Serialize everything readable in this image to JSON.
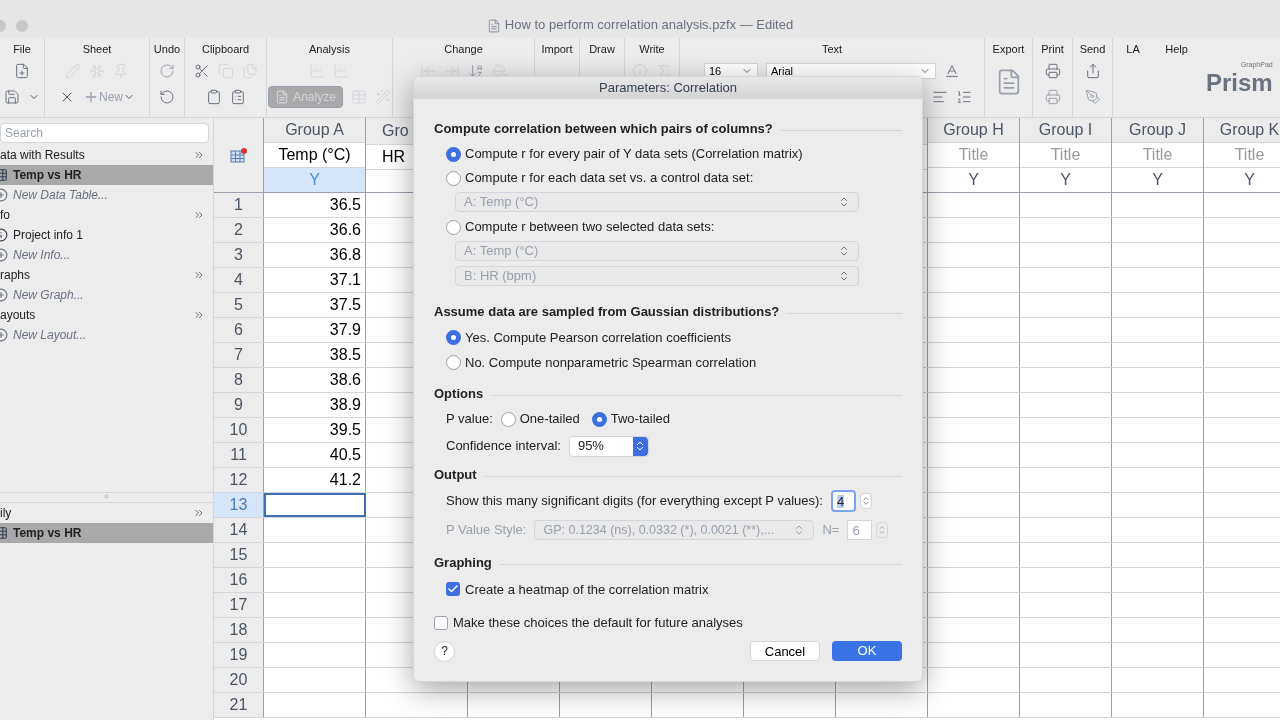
{
  "window": {
    "title": "How to perform correlation analysis.pzfx — Edited"
  },
  "toolbar": {
    "groups": [
      {
        "label": "File"
      },
      {
        "label": "Sheet"
      },
      {
        "label": "Undo"
      },
      {
        "label": "Clipboard"
      },
      {
        "label": "Analysis"
      },
      {
        "label": "Change"
      },
      {
        "label": "Import"
      },
      {
        "label": "Draw"
      },
      {
        "label": "Write"
      },
      {
        "label": "Text"
      },
      {
        "label": "Export"
      },
      {
        "label": "Print"
      },
      {
        "label": "Send"
      },
      {
        "label": "LA"
      },
      {
        "label": "Help"
      }
    ],
    "new_button": "New",
    "analyze_button": "Analyze",
    "font_size": "16",
    "font_name": "Arial",
    "logo_small": "GraphPad",
    "logo": "Prism"
  },
  "sidebar": {
    "search_placeholder": "Search",
    "sections": [
      {
        "title": "ata with Results",
        "items": [
          {
            "label": "Temp vs HR",
            "kind": "table",
            "selected": true
          },
          {
            "label": "New Data Table...",
            "kind": "new",
            "selected": false
          }
        ]
      },
      {
        "title": "fo",
        "items": [
          {
            "label": "Project info 1",
            "kind": "info",
            "selected": false
          },
          {
            "label": "New Info...",
            "kind": "new",
            "selected": false
          }
        ]
      },
      {
        "title": "raphs",
        "items": [
          {
            "label": "New Graph...",
            "kind": "new",
            "selected": false
          }
        ]
      },
      {
        "title": "ayouts",
        "items": [
          {
            "label": "New Layout...",
            "kind": "new",
            "selected": false
          }
        ]
      }
    ],
    "family": {
      "title": "ily",
      "items": [
        {
          "label": "Temp vs HR",
          "kind": "table",
          "selected": true
        }
      ]
    }
  },
  "sheet": {
    "columns": [
      {
        "group": "Group A",
        "title": "Temp (°C)",
        "title_placeholder": false,
        "y": "Y",
        "selected": true
      },
      {
        "group": "Gro",
        "title": "HR",
        "title_placeholder": false
      },
      {
        "group": "Group H",
        "title": "Title",
        "title_placeholder": true,
        "y": "Y",
        "selected": false
      },
      {
        "group": "Group I",
        "title": "Title",
        "title_placeholder": true,
        "y": "Y",
        "selected": false
      },
      {
        "group": "Group J",
        "title": "Title",
        "title_placeholder": true,
        "y": "Y",
        "selected": false
      },
      {
        "group": "Group K",
        "title": "Title",
        "title_placeholder": true,
        "y": "Y",
        "selected": false
      }
    ],
    "rows": [
      {
        "number": "1",
        "value": "36.5",
        "selected": false
      },
      {
        "number": "2",
        "value": "36.6",
        "selected": false
      },
      {
        "number": "3",
        "value": "36.8",
        "selected": false
      },
      {
        "number": "4",
        "value": "37.1",
        "selected": false
      },
      {
        "number": "5",
        "value": "37.5",
        "selected": false
      },
      {
        "number": "6",
        "value": "37.9",
        "selected": false
      },
      {
        "number": "7",
        "value": "38.5",
        "selected": false
      },
      {
        "number": "8",
        "value": "38.6",
        "selected": false
      },
      {
        "number": "9",
        "value": "38.9",
        "selected": false
      },
      {
        "number": "10",
        "value": "39.5",
        "selected": false
      },
      {
        "number": "11",
        "value": "40.5",
        "selected": false
      },
      {
        "number": "12",
        "value": "41.2",
        "selected": false
      },
      {
        "number": "13",
        "selected": true
      },
      {
        "number": "14",
        "selected": false
      },
      {
        "number": "15",
        "selected": false
      },
      {
        "number": "16",
        "selected": false
      },
      {
        "number": "17",
        "selected": false
      },
      {
        "number": "18",
        "selected": false
      },
      {
        "number": "19",
        "selected": false
      },
      {
        "number": "20",
        "selected": false
      },
      {
        "number": "21",
        "selected": false
      }
    ]
  },
  "dialog": {
    "title": "Parameters: Correlation",
    "pairs": {
      "heading": "Compute correlation between which pairs of columns?",
      "options": [
        {
          "label": "Compute r for every pair of Y data sets (Correlation matrix)",
          "selected": true
        },
        {
          "label": "Compute r for each data set vs. a control data set:",
          "selected": false,
          "selects": [
            {
              "value": "A: Temp (°C)",
              "disabled": true
            }
          ]
        },
        {
          "label": "Compute r between two selected data sets:",
          "selected": false,
          "selects": [
            {
              "value": "A: Temp (°C)",
              "disabled": true
            },
            {
              "value": "B: HR (bpm)",
              "disabled": true
            }
          ]
        }
      ]
    },
    "gaussian": {
      "heading": "Assume data are sampled from Gaussian distributions?",
      "options": [
        {
          "label": "Yes. Compute Pearson correlation coefficients",
          "selected": true
        },
        {
          "label": "No. Compute nonparametric Spearman correlation",
          "selected": false
        }
      ]
    },
    "options": {
      "heading": "Options",
      "p_value_label": "P value:",
      "tails": [
        {
          "label": "One-tailed",
          "selected": false
        },
        {
          "label": "Two-tailed",
          "selected": true
        }
      ],
      "ci_label": "Confidence interval:",
      "ci_value": "95%"
    },
    "output": {
      "heading": "Output",
      "digits_label": "Show this many significant digits (for everything except P values):",
      "digits_value": "4",
      "p_style_label": "P Value Style:",
      "p_style_value": "GP: 0.1234 (ns), 0.0332 (*), 0.0021 (**),...",
      "n_label": "N=",
      "n_value": "6",
      "p_style_disabled": true
    },
    "graphing": {
      "heading": "Graphing",
      "heatmap": {
        "label": "Create a heatmap of the correlation matrix",
        "checked": true
      }
    },
    "default_choice": {
      "label": "Make these choices the default for future analyses",
      "checked": false
    },
    "help": "?",
    "buttons": [
      {
        "label": "Cancel",
        "primary": false
      },
      {
        "label": "OK",
        "primary": true
      }
    ]
  }
}
